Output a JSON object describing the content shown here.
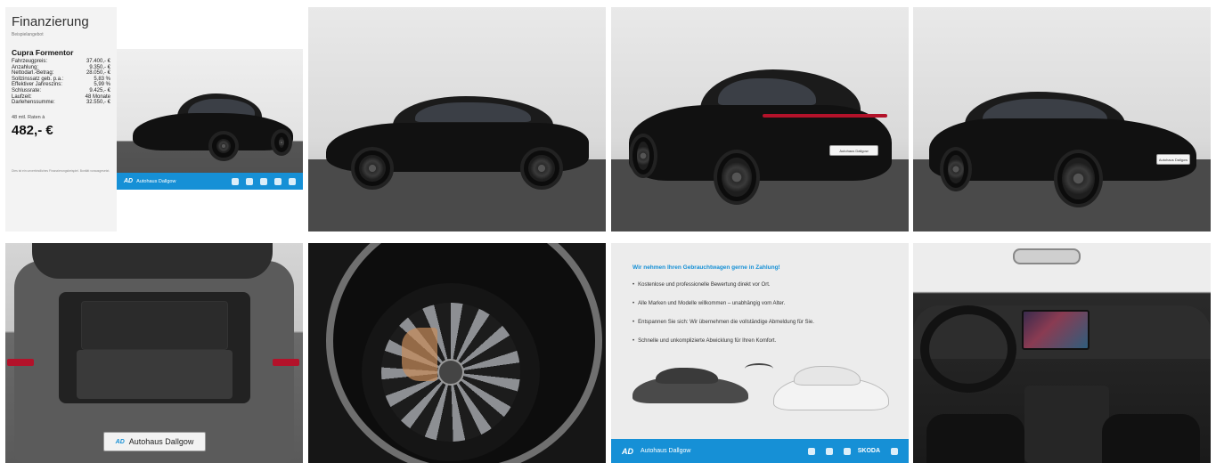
{
  "finance": {
    "title": "Finanzierung",
    "subtitle": "Beispielangebot",
    "model": "Cupra Formentor",
    "rows": [
      {
        "label": "Fahrzeugpreis:",
        "value": "37.400,- €"
      },
      {
        "label": "Anzahlung:",
        "value": "9.350,- €"
      },
      {
        "label": "Nettodarl.-Betrag:",
        "value": "28.050,- €"
      },
      {
        "label": "Sollzinssatz geb. p.a.:",
        "value": "5,83 %"
      },
      {
        "label": "Effektiver Jahreszins:",
        "value": "5,99 %"
      },
      {
        "label": "Schlussrate:",
        "value": "9.425,- €"
      },
      {
        "label": "Laufzeit:",
        "value": "48 Monate"
      },
      {
        "label": "Darlehenssumme:",
        "value": "32.550,- €"
      }
    ],
    "rate_label": "48 mtl. Raten à",
    "rate_value": "482,- €",
    "footnote": "Dies ist ein unverbindliches Finanzierungsbeispiel. Bonität vorausgesetzt.",
    "banner_brand": "Autohaus Dallgow"
  },
  "plate_text": "Autohaus Dallgow",
  "tradein": {
    "title": "Wir nehmen Ihren Gebrauchtwagen gerne in Zahlung!",
    "items": [
      "Kostenlose und professionelle Bewertung direkt vor Ort.",
      "Alle Marken und Modelle willkommen – unabhängig vom Alter.",
      "Entspannen Sie sich: Wir übernehmen die vollständige Abmeldung für Sie.",
      "Schnelle und unkomplizierte Abwicklung für Ihren Komfort."
    ],
    "bar_brand": "Autohaus Dallgow",
    "bar_partner": "SKODA"
  }
}
